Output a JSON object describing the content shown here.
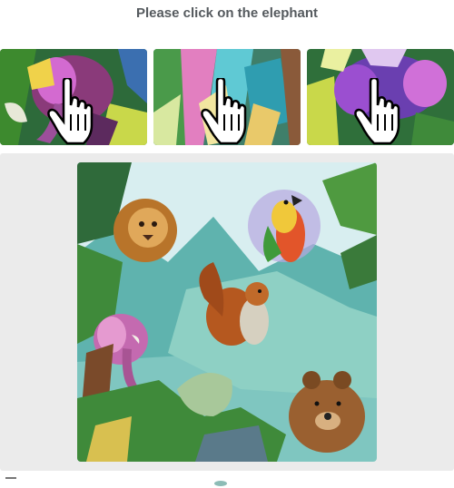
{
  "captcha": {
    "prompt": "Please click on the elephant",
    "choices": [
      {
        "icon": "elephant-tile-image"
      },
      {
        "icon": "abstract-tile-image"
      },
      {
        "icon": "elephant-tile-image"
      }
    ],
    "main_image_icon": "jungle-animals-scene",
    "colors": {
      "panel_bg": "#ebebeb",
      "prompt_text": "#555a5e",
      "accent": "#1b7a6e"
    }
  }
}
